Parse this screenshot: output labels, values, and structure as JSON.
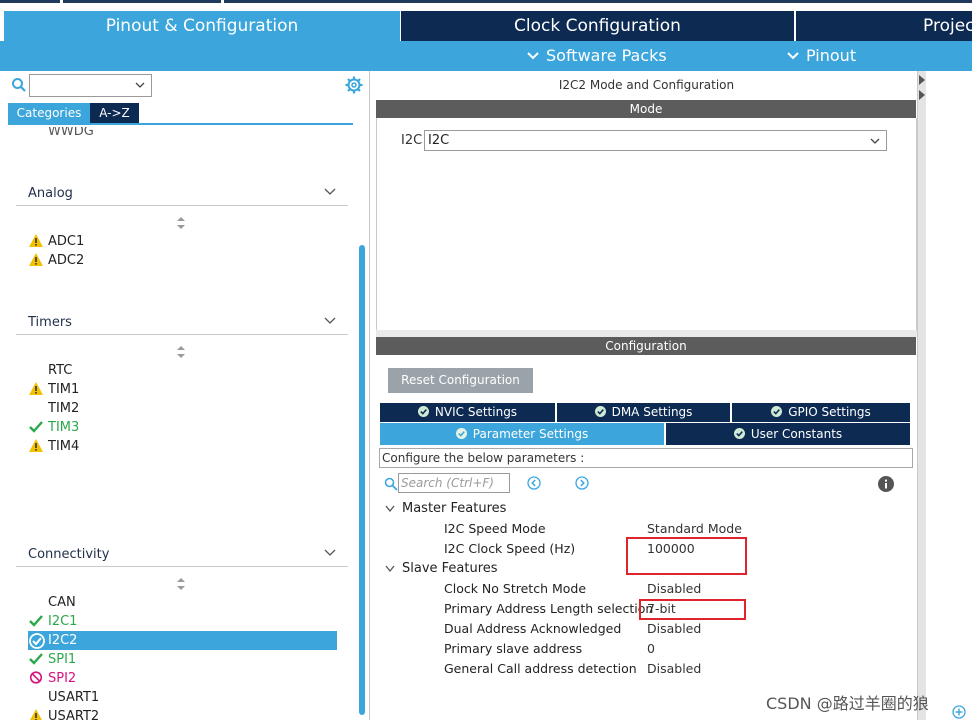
{
  "tabs": [
    {
      "label": "Pinout & Configuration"
    },
    {
      "label": "Clock Configuration"
    },
    {
      "label": "Projec"
    }
  ],
  "subtabs": {
    "software_packs": "Software Packs",
    "pinout": "Pinout"
  },
  "left": {
    "category_tab": "Categories",
    "az_tab": "A->Z",
    "top_item": "WWDG",
    "sections": {
      "analog": {
        "title": "Analog",
        "items": [
          "ADC1",
          "ADC2"
        ]
      },
      "timers": {
        "title": "Timers",
        "items": [
          "RTC",
          "TIM1",
          "TIM2",
          "TIM3",
          "TIM4"
        ]
      },
      "connectivity": {
        "title": "Connectivity",
        "items": [
          "CAN",
          "I2C1",
          "I2C2",
          "SPI1",
          "SPI2",
          "USART1",
          "USART2"
        ]
      }
    }
  },
  "mode_panel": {
    "header": "I2C2 Mode and Configuration",
    "mode_bar": "Mode",
    "i2c_label": "I2C",
    "i2c_value": "I2C"
  },
  "config_panel": {
    "bar": "Configuration",
    "reset_button": "Reset Configuration",
    "tabs": {
      "nvic": "NVIC Settings",
      "dma": "DMA Settings",
      "gpio": "GPIO Settings",
      "params": "Parameter Settings",
      "user": "User Constants"
    },
    "configure_text": "Configure the below parameters :",
    "search_placeholder": "Search (Ctrl+F)",
    "groups": {
      "master": "Master Features",
      "slave": "Slave Features"
    },
    "params": {
      "speed_mode": {
        "name": "I2C Speed Mode",
        "value": "Standard Mode"
      },
      "clock_speed": {
        "name": "I2C Clock Speed (Hz)",
        "value": "100000"
      },
      "no_stretch": {
        "name": "Clock No Stretch Mode",
        "value": "Disabled"
      },
      "addr_len": {
        "name": "Primary Address Length selection",
        "value": "7-bit"
      },
      "dual_addr": {
        "name": "Dual Address Acknowledged",
        "value": "Disabled"
      },
      "slave_addr": {
        "name": "Primary slave address",
        "value": "0"
      },
      "gen_call": {
        "name": "General Call address detection",
        "value": "Disabled"
      }
    }
  },
  "watermark": "CSDN @路过羊圈的狼",
  "colors": {
    "accent": "#3ca6dc",
    "navy": "#0c2a52",
    "green": "#2aa84a",
    "warning": "#f2c200",
    "pink": "#d6127c",
    "highlight": "#e0242c"
  }
}
